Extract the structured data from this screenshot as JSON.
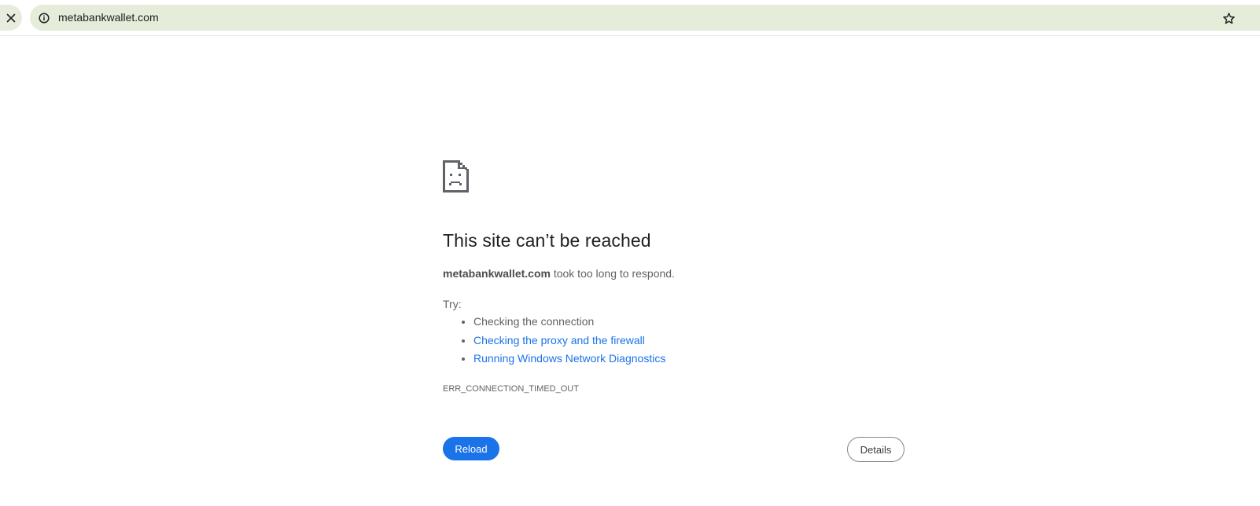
{
  "browser": {
    "stop_icon": "close-icon",
    "site_info_icon": "info-icon",
    "bookmark_icon": "star-icon",
    "url": "metabankwallet.com",
    "omnibox_color": "#e5ecd9"
  },
  "error_page": {
    "icon": "sad-page-icon",
    "title": "This site can’t be reached",
    "summary_host": "metabankwallet.com",
    "summary_rest": " took too long to respond.",
    "try_label": "Try:",
    "suggestions": [
      {
        "text": "Checking the connection",
        "is_link": false
      },
      {
        "text": "Checking the proxy and the firewall",
        "is_link": true
      },
      {
        "text": "Running Windows Network Diagnostics",
        "is_link": true
      }
    ],
    "error_code": "ERR_CONNECTION_TIMED_OUT",
    "reload_label": "Reload",
    "details_label": "Details",
    "accent_color": "#1a73e8",
    "link_color": "#1a73e8"
  }
}
